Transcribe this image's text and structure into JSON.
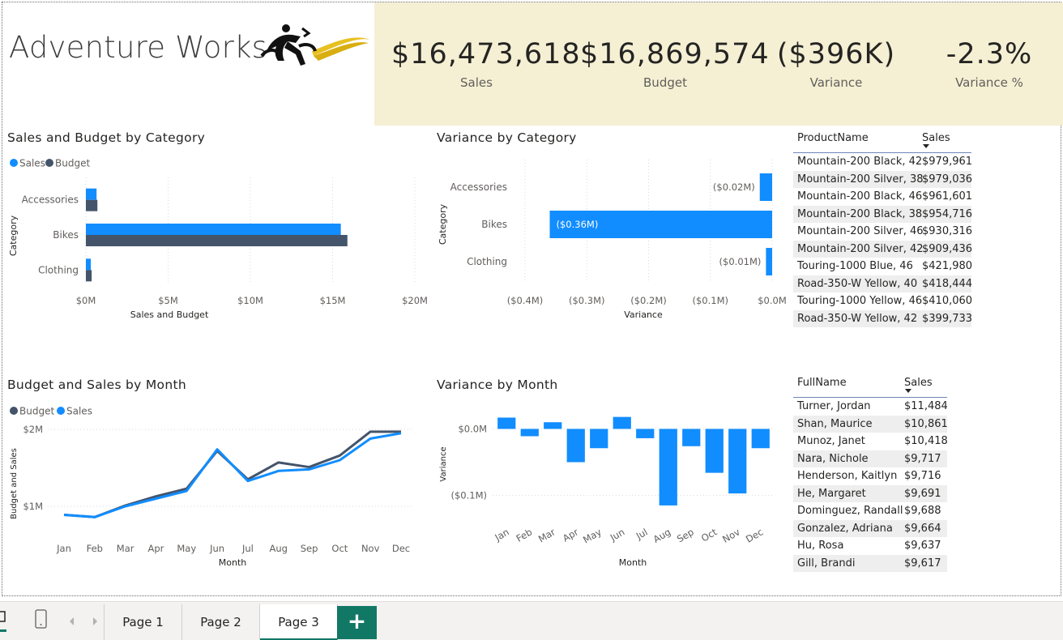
{
  "brand": {
    "title": "Adventure Works"
  },
  "kpis": [
    {
      "value": "$16,473,618",
      "label": "Sales"
    },
    {
      "value": "$16,869,574",
      "label": "Budget"
    },
    {
      "value": "($396K)",
      "label": "Variance"
    },
    {
      "value": "-2.3%",
      "label": "Variance %"
    }
  ],
  "colors": {
    "sales": "#118dff",
    "budget": "#44546a",
    "kpi_band": "#f5f0d3",
    "accent": "#117865"
  },
  "chart_data": [
    {
      "id": "sales-budget-by-category",
      "type": "bar",
      "orientation": "horizontal",
      "title": "Sales and Budget by Category",
      "xlabel": "Sales and Budget",
      "ylabel": "Category",
      "legend": [
        "Sales",
        "Budget"
      ],
      "legend_position": "top-left",
      "categories": [
        "Accessories",
        "Bikes",
        "Clothing"
      ],
      "series": [
        {
          "name": "Sales",
          "values": [
            0.65,
            15.5,
            0.3
          ]
        },
        {
          "name": "Budget",
          "values": [
            0.7,
            15.9,
            0.35
          ]
        }
      ],
      "xlim": [
        0,
        20
      ],
      "xticks": [
        "$0M",
        "$5M",
        "$10M",
        "$15M",
        "$20M"
      ]
    },
    {
      "id": "variance-by-category",
      "type": "bar",
      "orientation": "horizontal",
      "title": "Variance by Category",
      "xlabel": "Variance",
      "ylabel": "Category",
      "categories": [
        "Accessories",
        "Bikes",
        "Clothing"
      ],
      "values": [
        -0.02,
        -0.36,
        -0.01
      ],
      "data_labels": [
        "($0.02M)",
        "($0.36M)",
        "($0.01M)"
      ],
      "xlim": [
        -0.4,
        0
      ],
      "xticks": [
        "($0.4M)",
        "($0.3M)",
        "($0.2M)",
        "($0.1M)",
        "$0.0M"
      ]
    },
    {
      "id": "budget-sales-by-month",
      "type": "line",
      "title": "Budget and Sales by Month",
      "xlabel": "Month",
      "ylabel": "Budget and Sales",
      "legend": [
        "Budget",
        "Sales"
      ],
      "legend_position": "top-left",
      "categories": [
        "Jan",
        "Feb",
        "Mar",
        "Apr",
        "May",
        "Jun",
        "Jul",
        "Aug",
        "Sep",
        "Oct",
        "Nov",
        "Dec"
      ],
      "series": [
        {
          "name": "Budget",
          "values": [
            0.89,
            0.86,
            1.01,
            1.13,
            1.23,
            1.72,
            1.35,
            1.57,
            1.51,
            1.66,
            1.97,
            1.97
          ]
        },
        {
          "name": "Sales",
          "values": [
            0.89,
            0.86,
            1.0,
            1.1,
            1.2,
            1.74,
            1.33,
            1.46,
            1.48,
            1.6,
            1.88,
            1.95
          ]
        }
      ],
      "ylim": [
        0.6,
        2.0
      ],
      "yticks": [
        "$1M",
        "$2M"
      ],
      "ytick_values": [
        1,
        2
      ]
    },
    {
      "id": "variance-by-month",
      "type": "bar",
      "title": "Variance by Month",
      "xlabel": "Month",
      "ylabel": "Variance",
      "categories": [
        "Jan",
        "Feb",
        "Mar",
        "Apr",
        "May",
        "Jun",
        "Jul",
        "Aug",
        "Sep",
        "Oct",
        "Nov",
        "Dec"
      ],
      "values": [
        0.017,
        -0.011,
        0.01,
        -0.05,
        -0.029,
        0.018,
        -0.014,
        -0.115,
        -0.026,
        -0.066,
        -0.097,
        -0.029
      ],
      "ylim": [
        -0.12,
        0.02
      ],
      "yticks": [
        "$0.0M",
        "($0.1M)"
      ],
      "ytick_values": [
        0,
        -0.1
      ]
    }
  ],
  "products_table": {
    "headers": [
      "ProductName",
      "Sales"
    ],
    "rows": [
      [
        "Mountain-200 Black, 42",
        "$979,961"
      ],
      [
        "Mountain-200 Silver, 38",
        "$979,036"
      ],
      [
        "Mountain-200 Black, 46",
        "$961,601"
      ],
      [
        "Mountain-200 Black, 38",
        "$954,716"
      ],
      [
        "Mountain-200 Silver, 46",
        "$930,316"
      ],
      [
        "Mountain-200 Silver, 42",
        "$909,436"
      ],
      [
        "Touring-1000 Blue, 46",
        "$421,980"
      ],
      [
        "Road-350-W Yellow, 40",
        "$418,444"
      ],
      [
        "Touring-1000 Yellow, 46",
        "$410,060"
      ],
      [
        "Road-350-W Yellow, 42",
        "$399,733"
      ]
    ]
  },
  "customers_table": {
    "headers": [
      "FullName",
      "Sales"
    ],
    "rows": [
      [
        "Turner, Jordan",
        "$11,484"
      ],
      [
        "Shan, Maurice",
        "$10,861"
      ],
      [
        "Munoz, Janet",
        "$10,418"
      ],
      [
        "Nara, Nichole",
        "$9,717"
      ],
      [
        "Henderson, Kaitlyn",
        "$9,716"
      ],
      [
        "He, Margaret",
        "$9,691"
      ],
      [
        "Dominguez, Randall",
        "$9,688"
      ],
      [
        "Gonzalez, Adriana",
        "$9,664"
      ],
      [
        "Hu, Rosa",
        "$9,637"
      ],
      [
        "Gill, Brandi",
        "$9,617"
      ]
    ]
  },
  "pages": {
    "tabs": [
      "Page 1",
      "Page 2",
      "Page 3"
    ],
    "active": "Page 3",
    "add_label": "+"
  }
}
